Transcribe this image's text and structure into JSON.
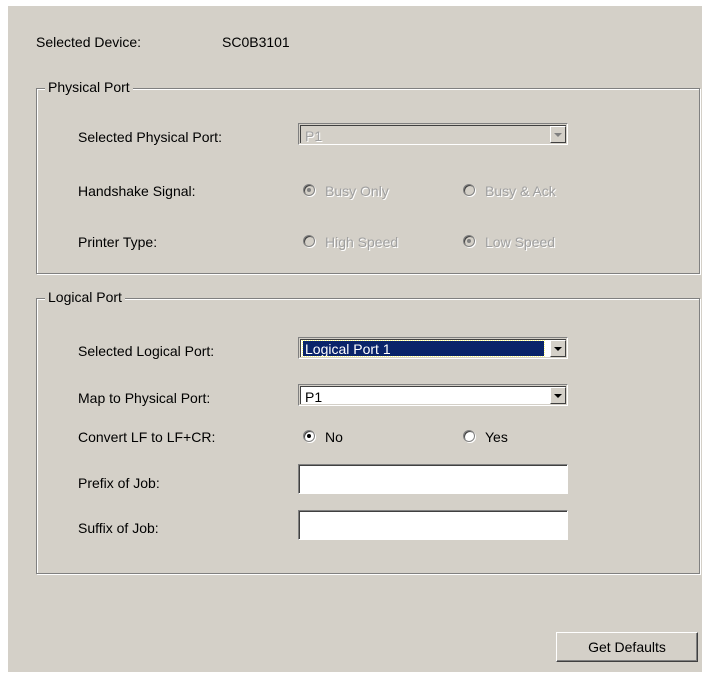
{
  "device": {
    "label": "Selected Device:",
    "value": "SC0B3101"
  },
  "physical_port": {
    "legend": "Physical Port",
    "selected_port_label": "Selected Physical Port:",
    "selected_port_value": "P1",
    "handshake_label": "Handshake Signal:",
    "handshake_options": [
      "Busy Only",
      "Busy & Ack"
    ],
    "handshake_selected": "Busy Only",
    "printer_type_label": "Printer Type:",
    "printer_type_options": [
      "High Speed",
      "Low Speed"
    ],
    "printer_type_selected": "Low Speed"
  },
  "logical_port": {
    "legend": "Logical Port",
    "selected_port_label": "Selected Logical Port:",
    "selected_port_value": "Logical Port 1",
    "map_label": "Map to Physical Port:",
    "map_value": "P1",
    "convert_label": "Convert LF to LF+CR:",
    "convert_options": [
      "No",
      "Yes"
    ],
    "convert_selected": "No",
    "prefix_label": "Prefix of Job:",
    "prefix_value": "",
    "suffix_label": "Suffix of Job:",
    "suffix_value": ""
  },
  "buttons": {
    "get_defaults": "Get Defaults"
  }
}
